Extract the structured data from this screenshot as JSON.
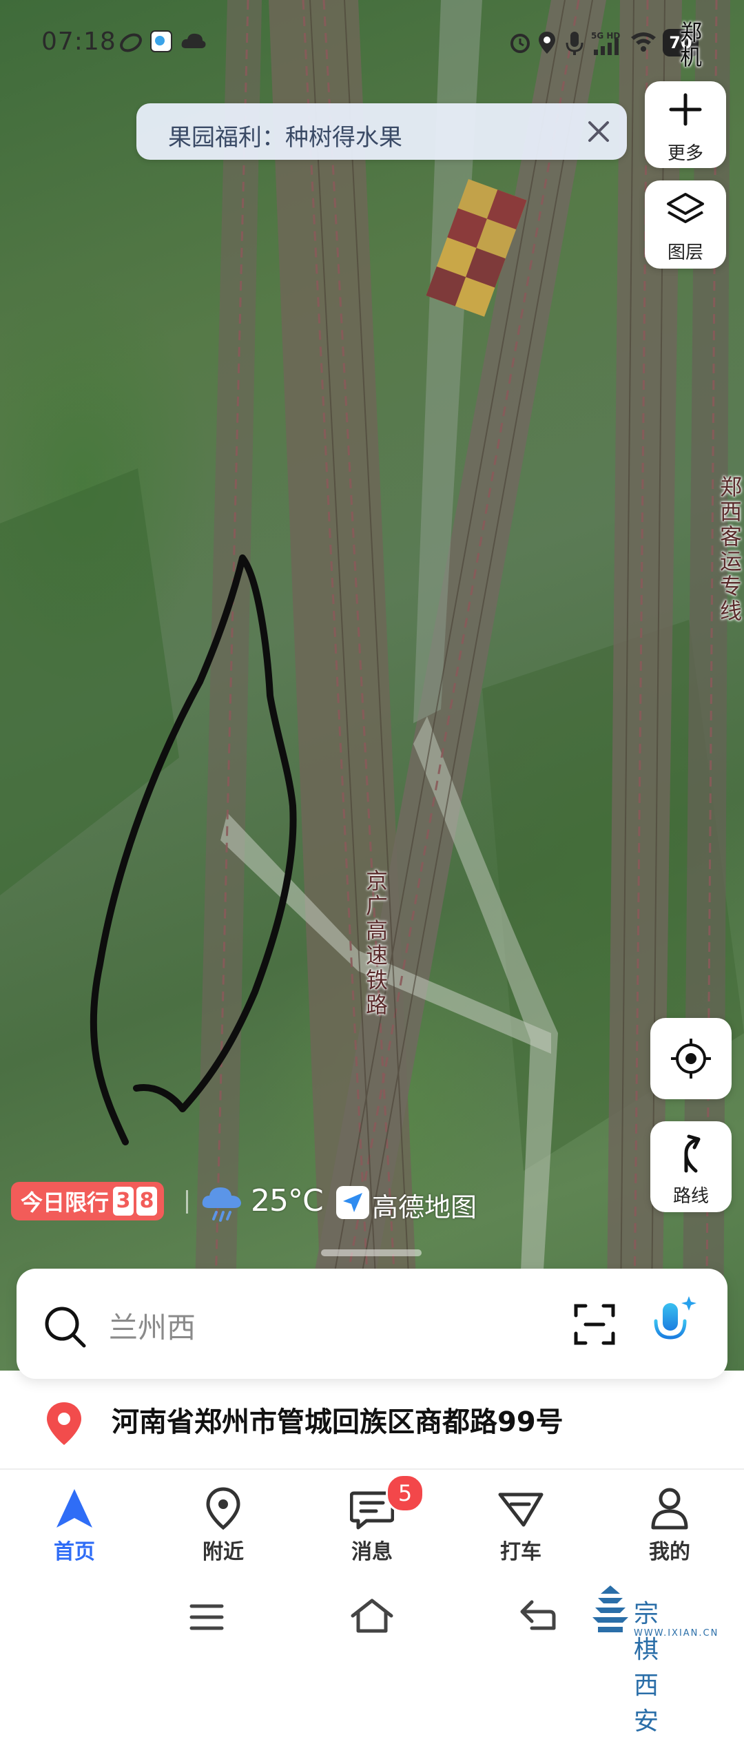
{
  "status_bar": {
    "time": "07:18",
    "battery": "70",
    "network": "5G HD"
  },
  "banner": {
    "text": "果园福利：种树得水果"
  },
  "map_buttons": {
    "more": "更多",
    "layers": "图层",
    "route": "路线"
  },
  "map_labels": {
    "rail_main": "京广高速铁路",
    "rail_right": "郑西客运专线",
    "top_right": "郑机"
  },
  "info_row": {
    "restriction_label": "今日限行",
    "restriction_num1": "3",
    "restriction_num2": "8",
    "temperature": "25°C",
    "brand": "高德地图"
  },
  "search": {
    "placeholder": "兰州西"
  },
  "location": {
    "address": "河南省郑州市管城回族区商都路99号"
  },
  "tabs": [
    {
      "label": "首页",
      "icon": "navigate-arrow-icon",
      "active": true
    },
    {
      "label": "附近",
      "icon": "location-pin-icon"
    },
    {
      "label": "消息",
      "icon": "message-icon",
      "badge": "5"
    },
    {
      "label": "打车",
      "icon": "taxi-flag-icon"
    },
    {
      "label": "我的",
      "icon": "user-icon"
    }
  ],
  "watermark": {
    "name": "宗棋西安",
    "url": "WWW.IXIAN.CN"
  },
  "colors": {
    "accent": "#2f6df6",
    "restriction": "#f25c59",
    "badge": "#f3474a"
  }
}
